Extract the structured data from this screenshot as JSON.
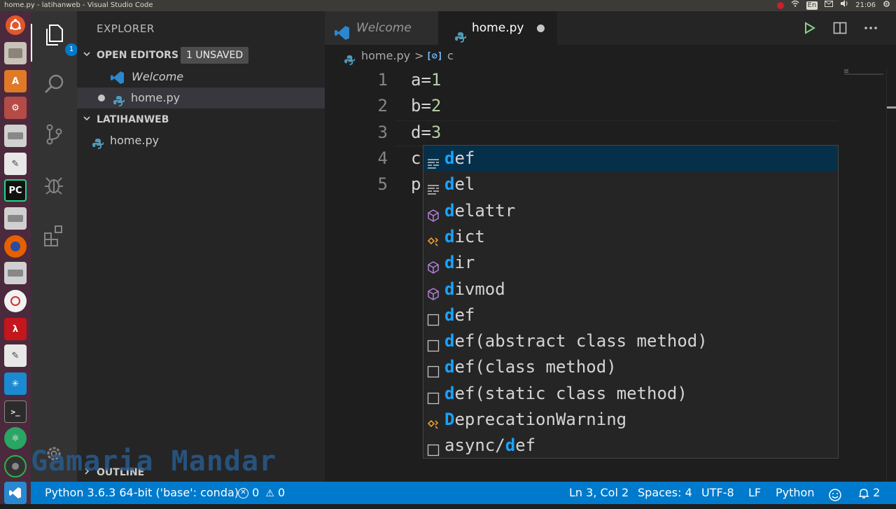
{
  "window_title": "home.py - latihanweb - Visual Studio Code",
  "system_tray": {
    "keyboard": "En",
    "time": "21:06"
  },
  "launcher_apps": [
    "ubuntu-icon",
    "files-icon",
    "software-center-icon",
    "settings-icon",
    "drive-icon",
    "text-editor-icon",
    "pycharm-icon",
    "drive-icon",
    "firefox-icon",
    "drive-icon",
    "libreoffice-icon",
    "acrobat-icon",
    "text-editor-icon",
    "snowflake-icon",
    "terminal-icon",
    "atom-icon",
    "camera-icon",
    "vscode-icon"
  ],
  "launcher_pycharm_label": "PC",
  "activity_bar": {
    "explorer_badge": "1"
  },
  "sidebar": {
    "title": "EXPLORER",
    "open_editors": {
      "label": "OPEN EDITORS",
      "unsaved_badge": "1 UNSAVED",
      "items": [
        {
          "label": "Welcome"
        },
        {
          "label": "home.py"
        }
      ]
    },
    "workspace": {
      "label": "LATIHANWEB",
      "items": [
        {
          "label": "home.py"
        }
      ]
    },
    "outline": {
      "label": "OUTLINE"
    }
  },
  "tabs": [
    {
      "label": "Welcome"
    },
    {
      "label": "home.py"
    }
  ],
  "breadcrumb": {
    "file": "home.py",
    "separator": ">",
    "symbol": "c"
  },
  "editor": {
    "line_numbers": [
      "1",
      "2",
      "3",
      "4",
      "5"
    ],
    "lines": [
      {
        "text": "a=",
        "num": "1"
      },
      {
        "text": "b=",
        "num": "2"
      },
      {
        "text": "d=",
        "num": "3"
      },
      {
        "text": "c",
        "num": ""
      },
      {
        "text": "p",
        "num": ""
      }
    ]
  },
  "suggestions": [
    {
      "match": "d",
      "rest": "ef",
      "icon": "keyword-icon"
    },
    {
      "match": "d",
      "rest": "el",
      "icon": "keyword-icon"
    },
    {
      "match": "d",
      "rest": "elattr",
      "icon": "method-icon"
    },
    {
      "match": "d",
      "rest": "ict",
      "icon": "class-icon"
    },
    {
      "match": "d",
      "rest": "ir",
      "icon": "method-icon"
    },
    {
      "match": "d",
      "rest": "ivmod",
      "icon": "method-icon"
    },
    {
      "match": "d",
      "rest": "ef",
      "icon": "snippet-icon"
    },
    {
      "match": "d",
      "rest": "ef(abstract class method)",
      "icon": "snippet-icon"
    },
    {
      "match": "d",
      "rest": "ef(class method)",
      "icon": "snippet-icon"
    },
    {
      "match": "d",
      "rest": "ef(static class method)",
      "icon": "snippet-icon"
    },
    {
      "match": "D",
      "rest": "eprecationWarning",
      "icon": "class-icon"
    },
    {
      "prefix": "async/",
      "match": "d",
      "rest": "ef",
      "icon": "snippet-icon"
    }
  ],
  "status_bar": {
    "interpreter": "Python 3.6.3 64-bit ('base': conda)",
    "errors": "0",
    "warnings": "0",
    "cursor": "Ln 3, Col 2",
    "spaces": "Spaces: 4",
    "encoding": "UTF-8",
    "eol": "LF",
    "language": "Python",
    "notifications": "2"
  },
  "watermark": "Gamaria Mandar",
  "colors": {
    "accent": "#007acc",
    "match": "#18a3ff",
    "number": "#b5cea8"
  }
}
